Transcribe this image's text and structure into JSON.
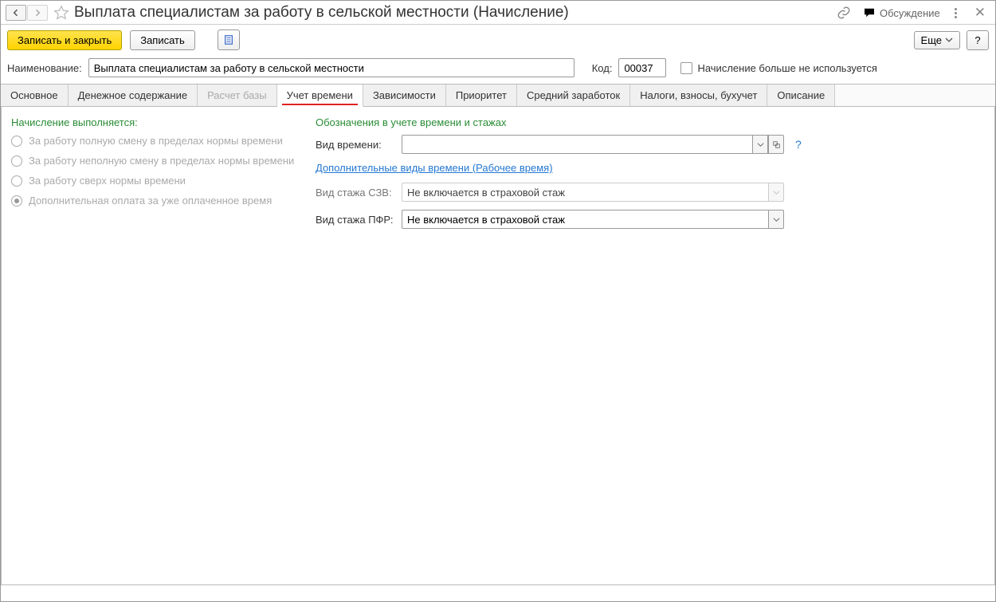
{
  "header": {
    "title": "Выплата специалистам за работу в сельской местности (Начисление)",
    "discussion_label": "Обсуждение"
  },
  "toolbar": {
    "save_close_label": "Записать и закрыть",
    "save_label": "Записать",
    "more_label": "Еще",
    "help_label": "?"
  },
  "fields": {
    "name_label": "Наименование:",
    "name_value": "Выплата специалистам за работу в сельской местности",
    "code_label": "Код:",
    "code_value": "00037",
    "unused_label": "Начисление больше не используется"
  },
  "tabs": {
    "items": [
      {
        "label": "Основное",
        "active": false,
        "disabled": false
      },
      {
        "label": "Денежное содержание",
        "active": false,
        "disabled": false
      },
      {
        "label": "Расчет базы",
        "active": false,
        "disabled": true
      },
      {
        "label": "Учет времени",
        "active": true,
        "disabled": false
      },
      {
        "label": "Зависимости",
        "active": false,
        "disabled": false
      },
      {
        "label": "Приоритет",
        "active": false,
        "disabled": false
      },
      {
        "label": "Средний заработок",
        "active": false,
        "disabled": false
      },
      {
        "label": "Налоги, взносы, бухучет",
        "active": false,
        "disabled": false
      },
      {
        "label": "Описание",
        "active": false,
        "disabled": false
      }
    ]
  },
  "left_panel": {
    "title": "Начисление выполняется:",
    "options": [
      {
        "label": "За работу полную смену в пределах нормы времени",
        "selected": false
      },
      {
        "label": "За работу неполную смену в пределах нормы времени",
        "selected": false
      },
      {
        "label": "За работу сверх нормы времени",
        "selected": false
      },
      {
        "label": "Дополнительная оплата за уже оплаченное время",
        "selected": true
      }
    ]
  },
  "right_panel": {
    "title": "Обозначения в учете времени и стажах",
    "time_type_label": "Вид времени:",
    "time_type_value": "",
    "extra_link": "Дополнительные виды времени (Рабочее время)",
    "szv_label": "Вид стажа СЗВ:",
    "szv_value": "Не включается в страховой стаж",
    "pfr_label": "Вид стажа ПФР:",
    "pfr_value": "Не включается в страховой стаж"
  }
}
